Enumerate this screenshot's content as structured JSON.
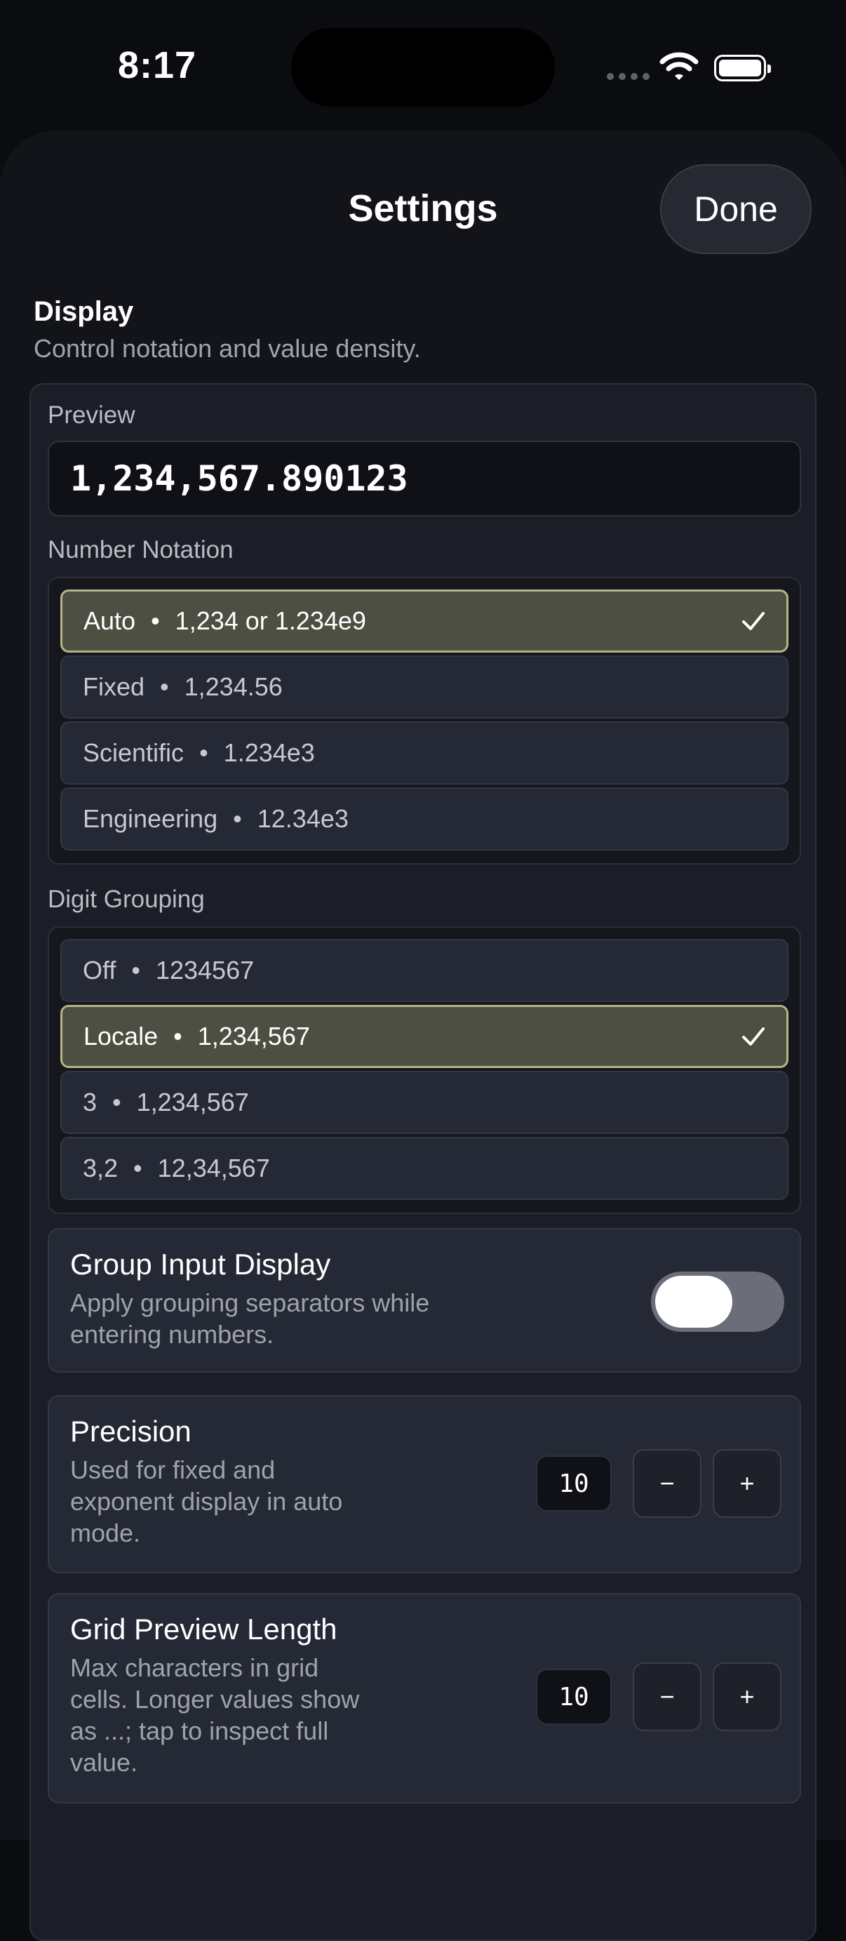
{
  "status": {
    "time": "8:17"
  },
  "header": {
    "title": "Settings",
    "done_label": "Done"
  },
  "section": {
    "title": "Display",
    "subtitle": "Control notation and value density."
  },
  "preview": {
    "label": "Preview",
    "value": "1,234,567.890123"
  },
  "notation": {
    "label": "Number Notation",
    "options": [
      {
        "name": "Auto",
        "example": "1,234 or 1.234e9",
        "selected": true
      },
      {
        "name": "Fixed",
        "example": "1,234.56",
        "selected": false
      },
      {
        "name": "Scientific",
        "example": "1.234e3",
        "selected": false
      },
      {
        "name": "Engineering",
        "example": "12.34e3",
        "selected": false
      }
    ]
  },
  "grouping": {
    "label": "Digit Grouping",
    "options": [
      {
        "name": "Off",
        "example": "1234567",
        "selected": false
      },
      {
        "name": "Locale",
        "example": "1,234,567",
        "selected": true
      },
      {
        "name": "3",
        "example": "1,234,567",
        "selected": false
      },
      {
        "name": "3,2",
        "example": "12,34,567",
        "selected": false
      }
    ]
  },
  "group_input": {
    "title": "Group Input Display",
    "description_lines": [
      "Apply grouping separators while",
      "entering numbers."
    ],
    "enabled": false
  },
  "precision": {
    "title": "Precision",
    "description_lines": [
      "Used for fixed and",
      "exponent display in auto",
      "mode."
    ],
    "value": "10",
    "minus": "−",
    "plus": "+"
  },
  "grid_preview": {
    "title": "Grid Preview Length",
    "description_lines": [
      "Max characters in grid",
      "cells. Longer values show",
      "as ...; tap to inspect full",
      "value."
    ],
    "value": "10",
    "minus": "−",
    "plus": "+"
  },
  "colors": {
    "selected_bg": "#4d4f42",
    "selected_border": "#b3b48a",
    "sheet_bg": "#121419"
  }
}
